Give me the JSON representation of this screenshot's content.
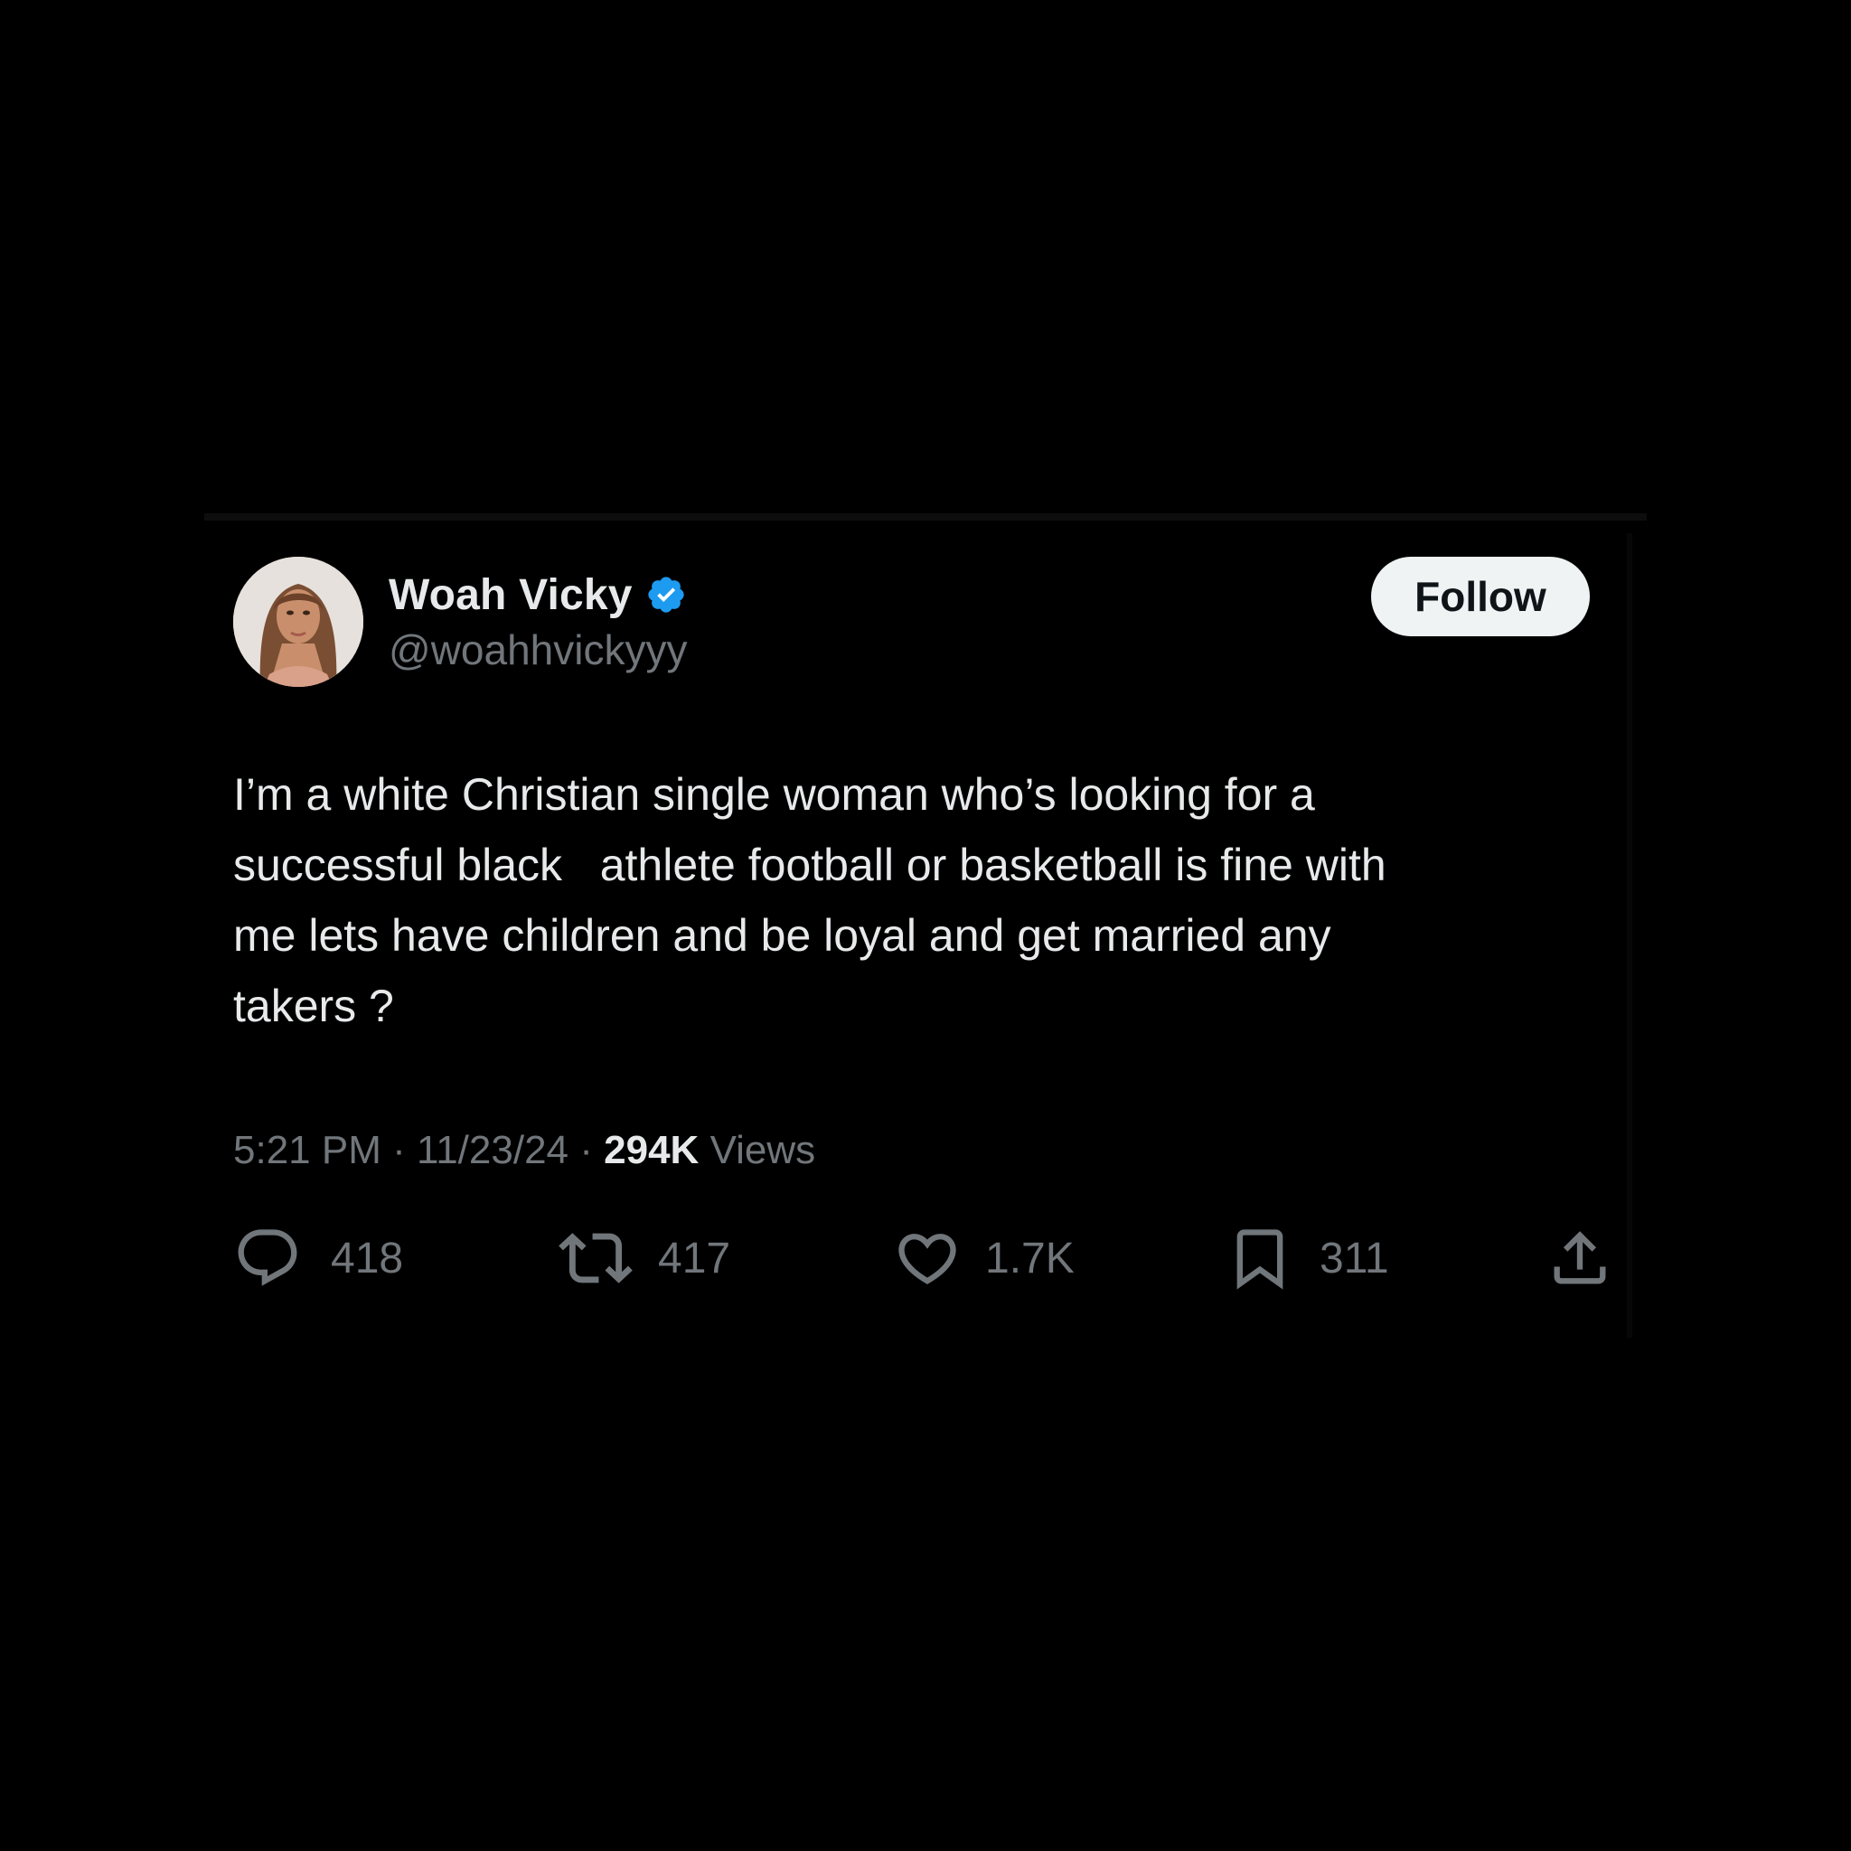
{
  "author": {
    "display_name": "Woah Vicky",
    "handle": "@woahhvickyyy",
    "verified": true,
    "verified_color": "#1d9bf0",
    "avatar_icon": "profile-photo"
  },
  "follow_button": {
    "label": "Follow"
  },
  "tweet": {
    "text": "I’m a white Christian single woman who’s looking for a\nsuccessful black   athlete football or basketball is fine with\nme lets have children and be loyal and get married any\ntakers ?"
  },
  "meta": {
    "time": "5:21 PM",
    "separator": "·",
    "date": "11/23/24",
    "views_count": "294K",
    "views_label": "Views"
  },
  "actions": {
    "replies": {
      "icon": "reply-icon",
      "count": "418"
    },
    "reposts": {
      "icon": "repost-icon",
      "count": "417"
    },
    "likes": {
      "icon": "like-icon",
      "count": "1.7K"
    },
    "bookmarks": {
      "icon": "bookmark-icon",
      "count": "311"
    },
    "share": {
      "icon": "share-icon"
    }
  },
  "colors": {
    "background": "#000000",
    "primary_text": "#e7e9ea",
    "secondary_text": "#71767b",
    "button_bg": "#eff3f4"
  }
}
